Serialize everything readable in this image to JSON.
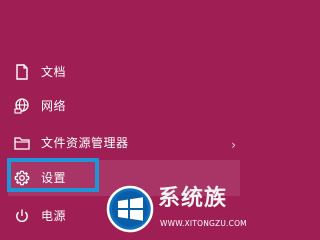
{
  "start_menu": {
    "items": [
      {
        "label": "文档",
        "icon": "document-icon"
      },
      {
        "label": "网络",
        "icon": "network-icon"
      },
      {
        "label": "文件资源管理器",
        "icon": "folder-icon",
        "has_submenu": true
      },
      {
        "label": "设置",
        "icon": "gear-icon",
        "highlighted": true
      },
      {
        "label": "电源",
        "icon": "power-icon"
      }
    ],
    "submenu_arrow": "›"
  },
  "watermark": {
    "title": "系统族",
    "url": "WWW.XITONGZU.COM"
  },
  "colors": {
    "background": "#9f1f55",
    "highlight_border": "#1e95d6",
    "text": "#ffffff"
  }
}
